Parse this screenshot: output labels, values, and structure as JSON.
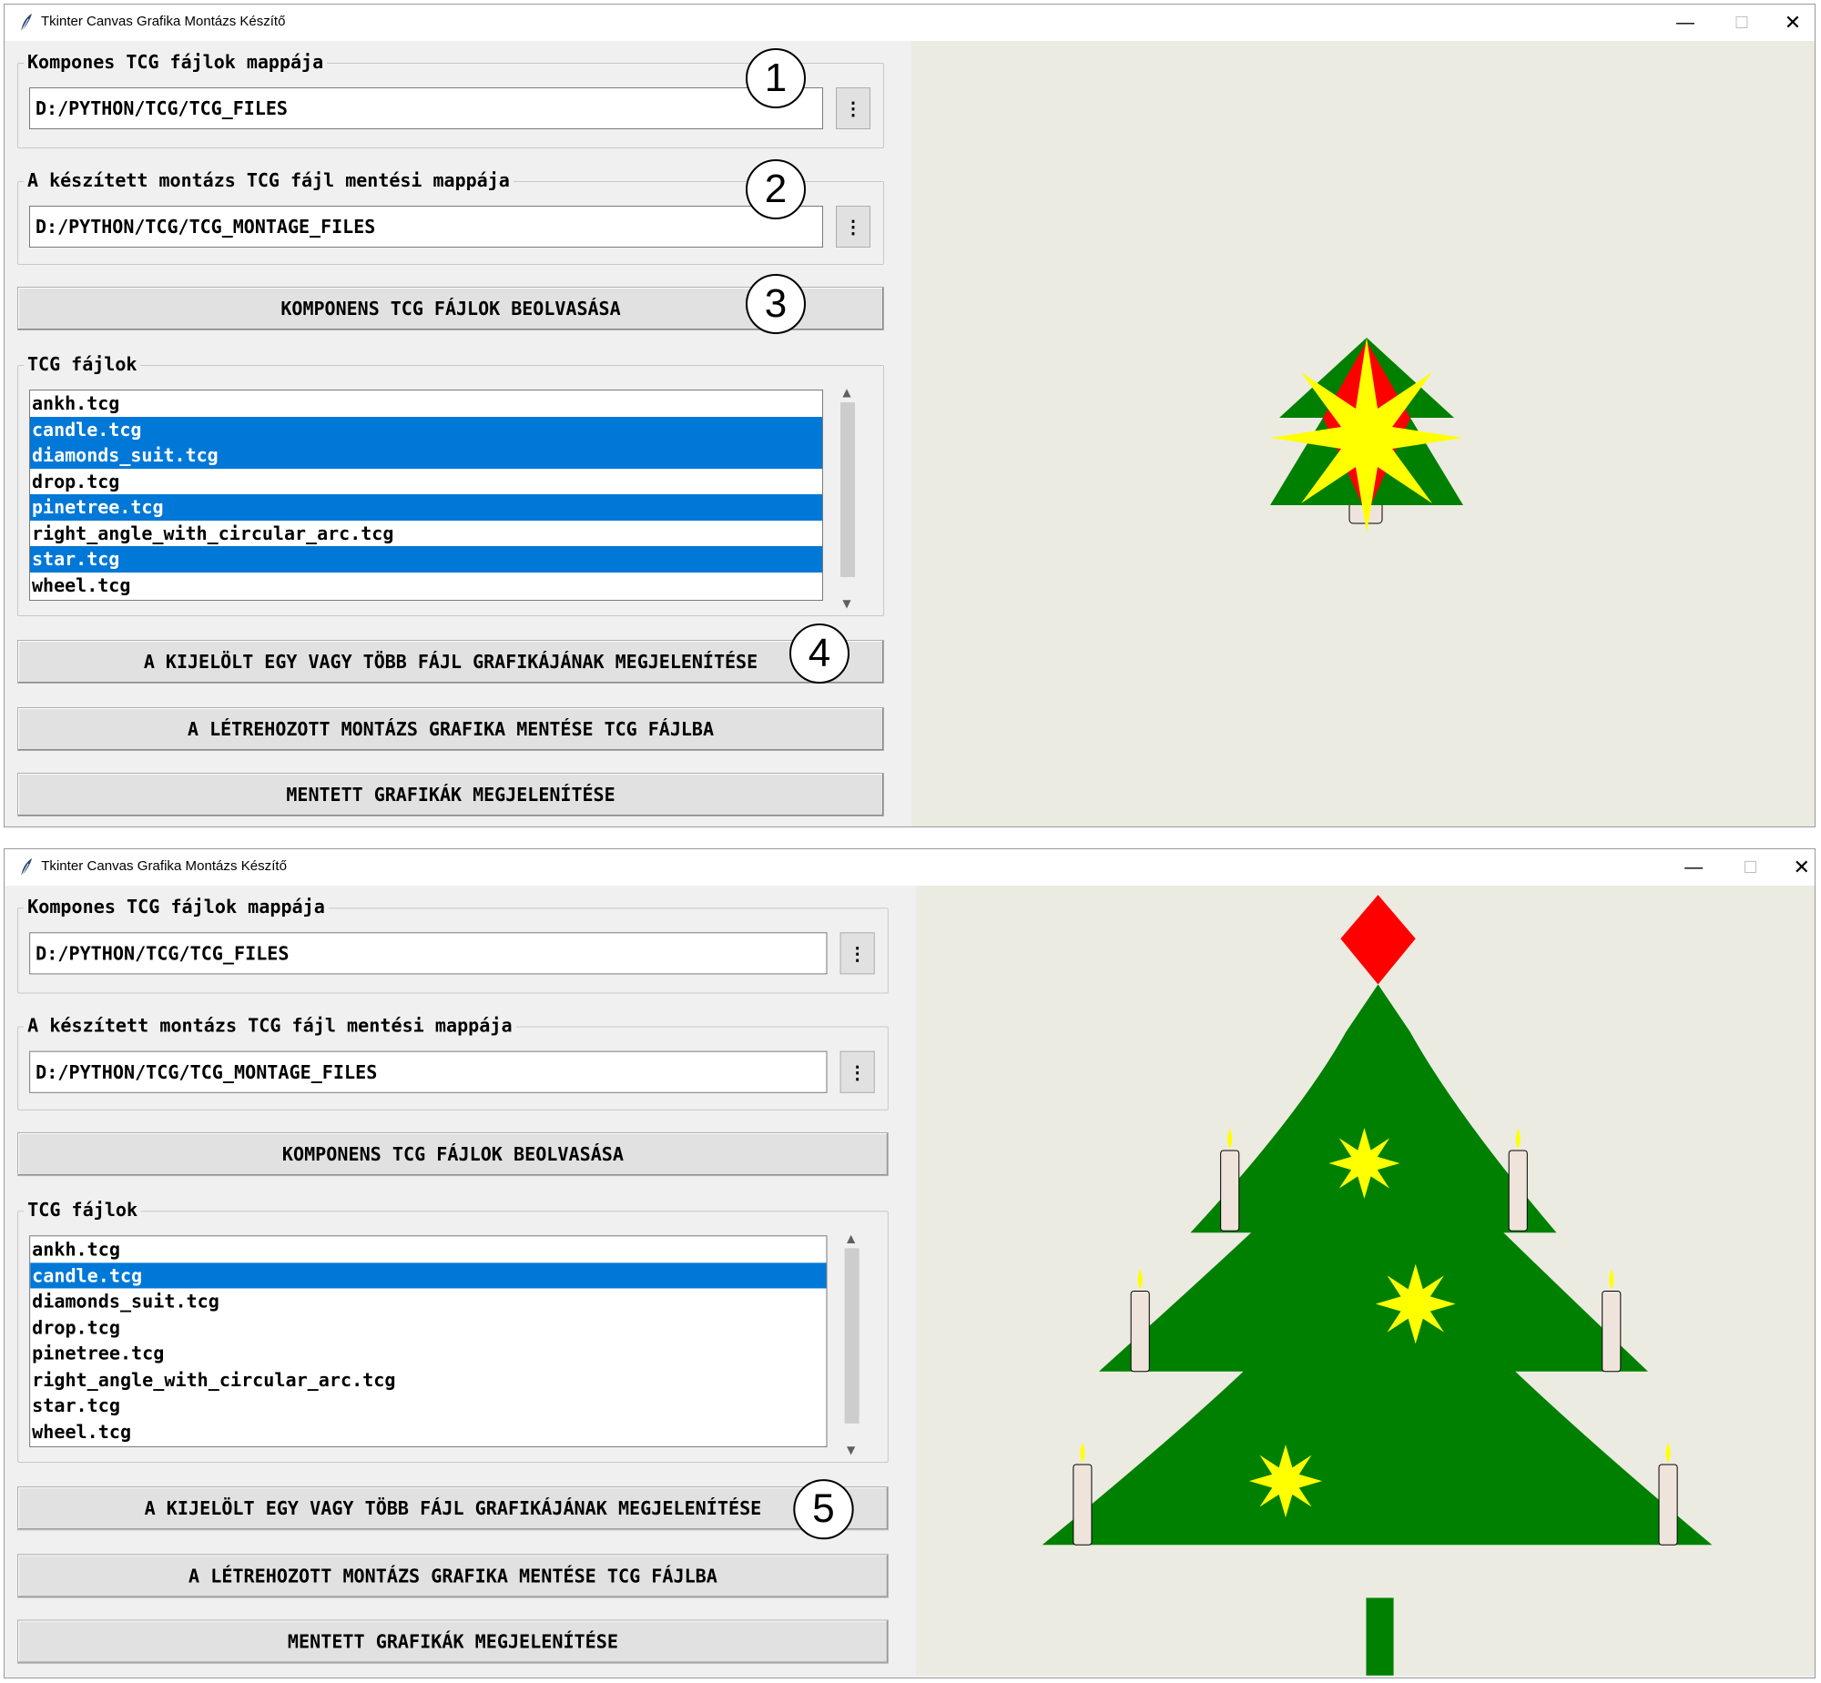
{
  "window_title": "Tkinter Canvas Grafika Montázs Készítő",
  "titlebar_buttons": {
    "minimize": "—",
    "maximize": "☐",
    "close": "✕"
  },
  "component_folder": {
    "label": "Kompones TCG fájlok mappája",
    "value": "D:/PYTHON/TCG/TCG_FILES",
    "browse_label": "⋮"
  },
  "save_folder": {
    "label": "A készített montázs TCG fájl mentési mappája",
    "value": "D:/PYTHON/TCG/TCG_MONTAGE_FILES",
    "browse_label": "⋮"
  },
  "buttons": {
    "load": "KOMPONENS TCG FÁJLOK BEOLVASÁSA",
    "show_selected": "A KIJELÖLT EGY VAGY TÖBB FÁJL GRAFIKÁJÁNAK MEGJELENÍTÉSE",
    "save_montage": "A LÉTREHOZOTT MONTÁZS GRAFIKA MENTÉSE TCG FÁJLBA",
    "show_saved": "MENTETT GRAFIKÁK MEGJELENÍTÉSE"
  },
  "file_list": {
    "label": "TCG fájlok",
    "items": [
      "ankh.tcg",
      "candle.tcg",
      "diamonds_suit.tcg",
      "drop.tcg",
      "pinetree.tcg",
      "right_angle_with_circular_arc.tcg",
      "star.tcg",
      "wheel.tcg"
    ]
  },
  "windows": [
    {
      "selected": [
        1,
        2,
        4,
        6
      ],
      "callouts": [
        "1",
        "2",
        "3",
        "4"
      ],
      "canvas": "overlay"
    },
    {
      "selected": [
        1
      ],
      "callouts": [
        "5"
      ],
      "canvas": "montage"
    }
  ],
  "colors": {
    "selection": "#0078d7",
    "canvas_bg": "#ecebe1",
    "tree_green": "#008000",
    "star_yellow": "#ffff00",
    "diamond_red": "#ff0000",
    "candle_body": "#efe4dc"
  },
  "icons": {
    "app": "feather-icon",
    "browse": "vertical-dots-icon",
    "scroll_up": "chevron-up-icon",
    "scroll_down": "chevron-down-icon"
  }
}
